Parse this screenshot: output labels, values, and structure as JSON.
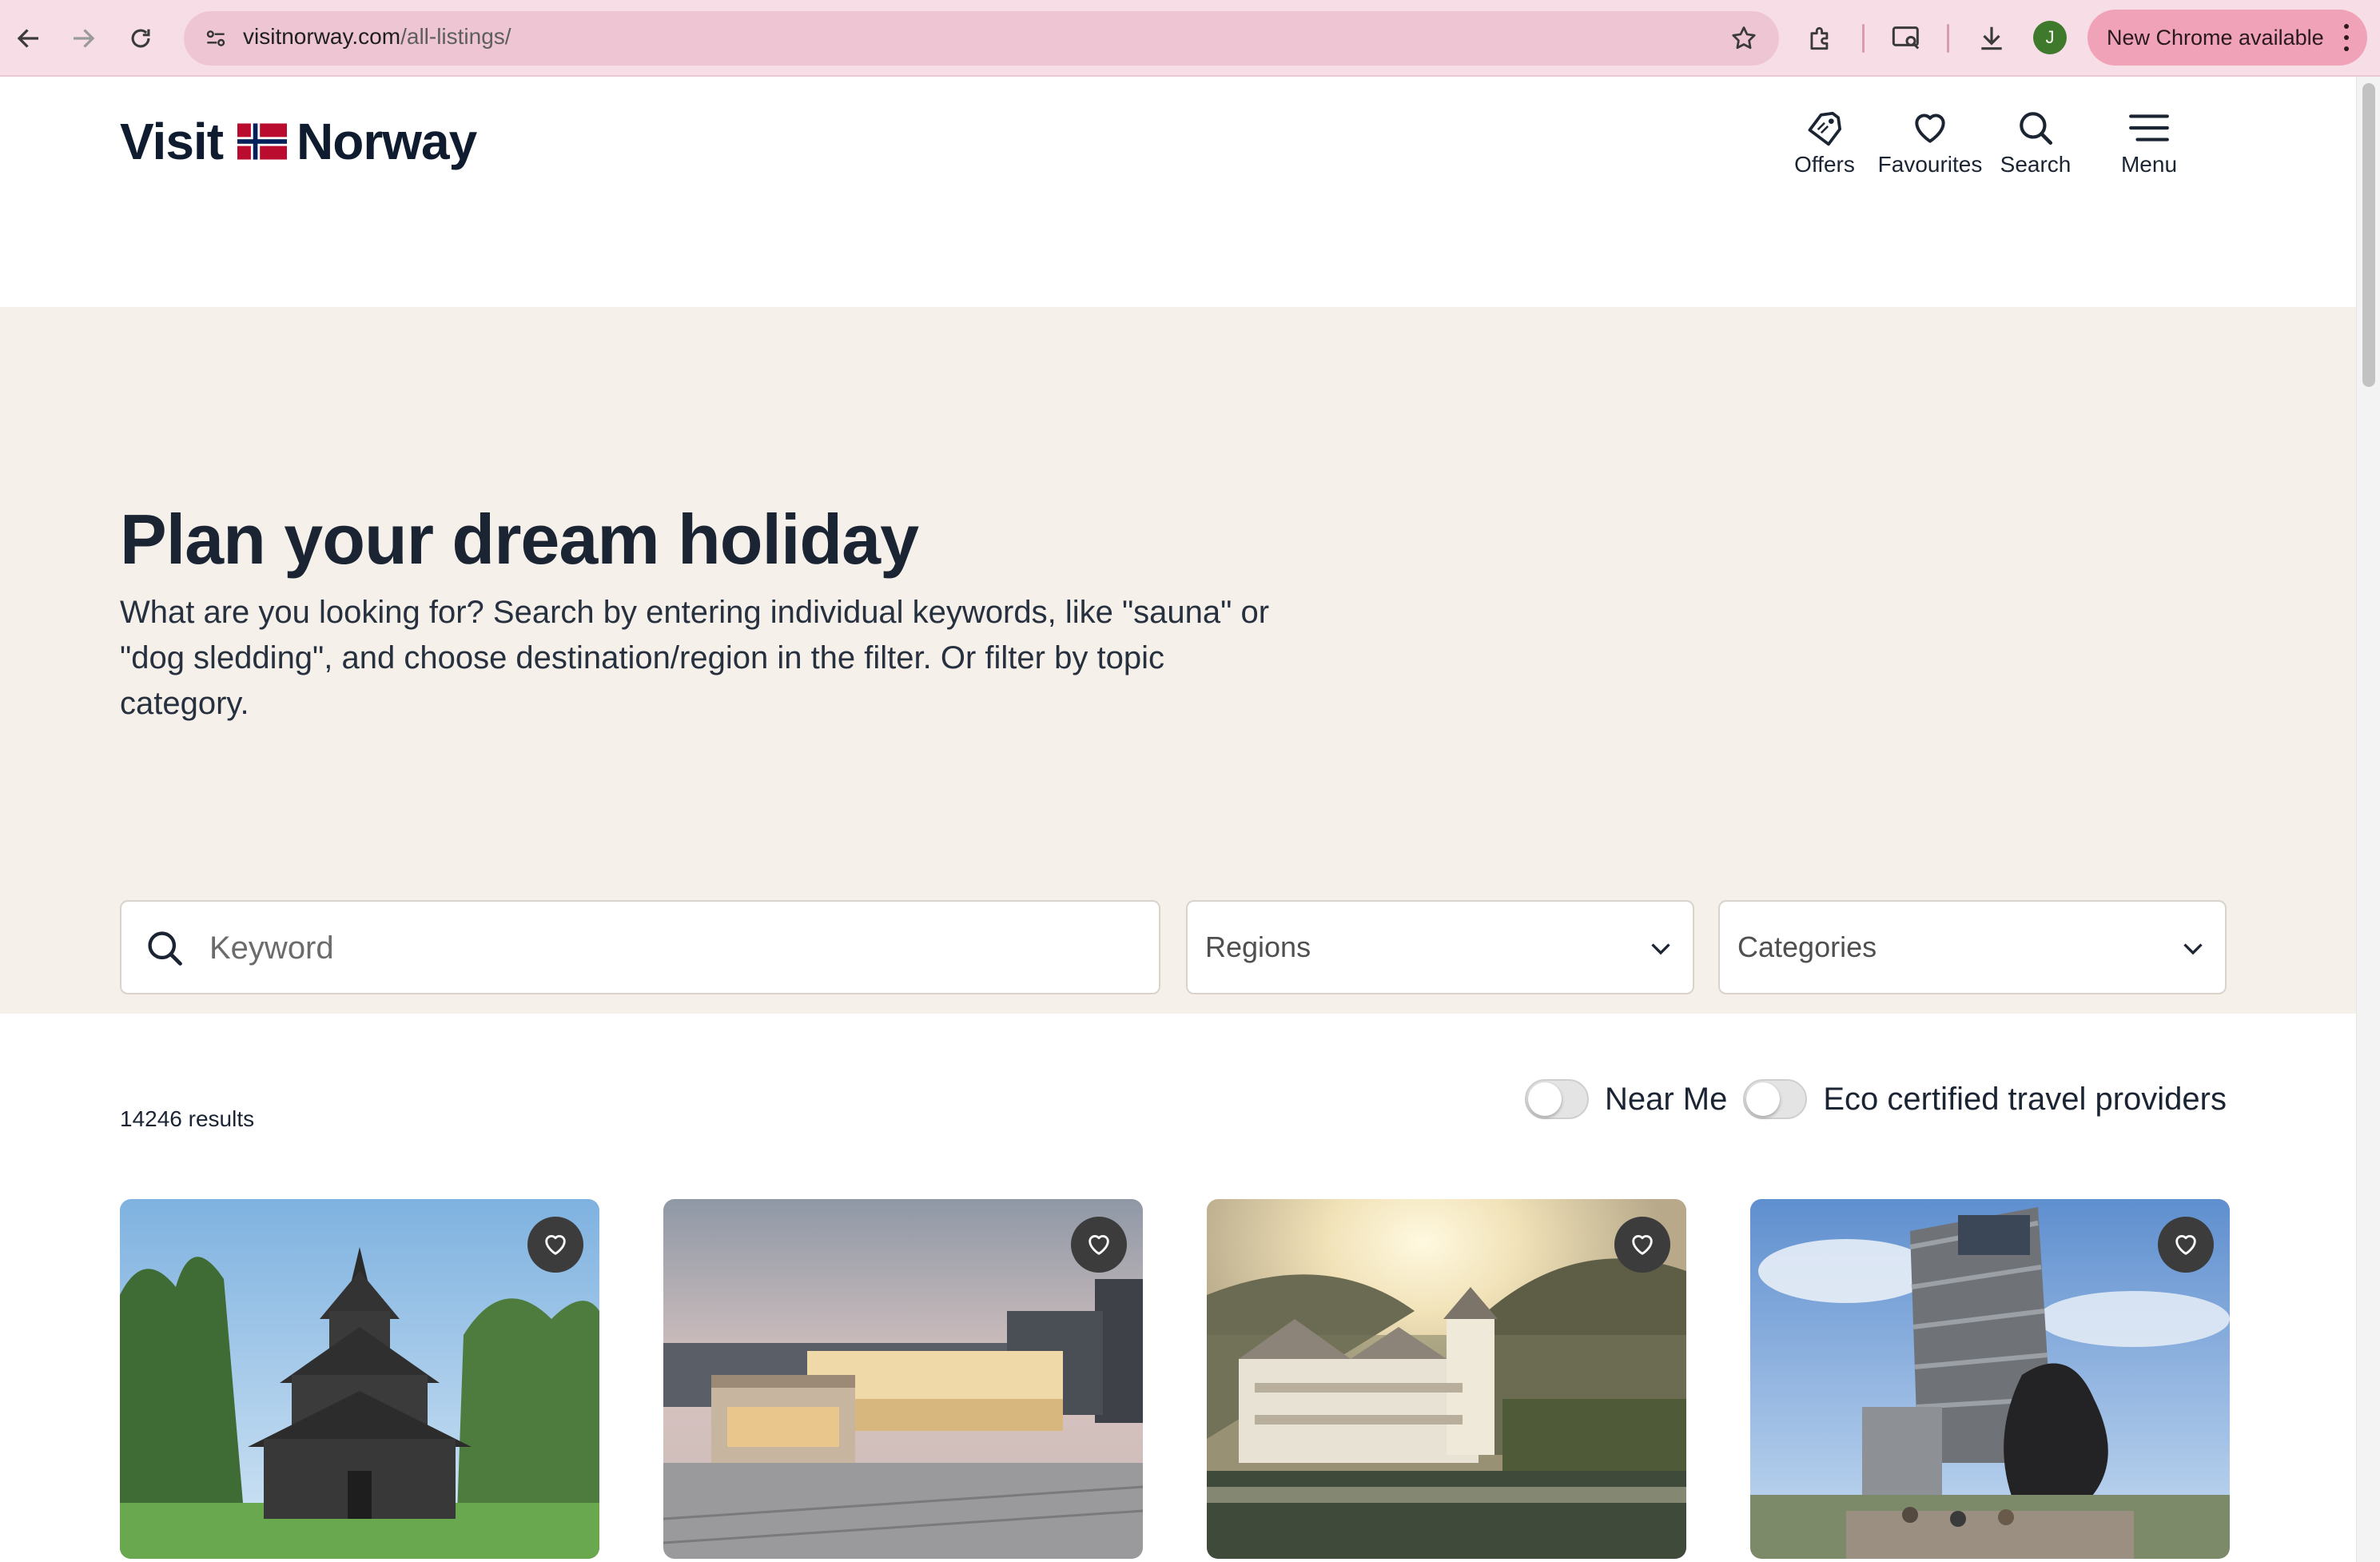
{
  "browser": {
    "url_host": "visitnorway.com",
    "url_path": "/all-listings/",
    "profile_initial": "J",
    "update_label": "New Chrome available"
  },
  "header": {
    "logo_left": "Visit",
    "logo_right": "Norway",
    "nav": [
      {
        "label": "Offers",
        "icon": "tag-icon"
      },
      {
        "label": "Favourites",
        "icon": "heart-icon"
      },
      {
        "label": "Search",
        "icon": "search-icon"
      },
      {
        "label": "Menu",
        "icon": "hamburger-icon"
      }
    ]
  },
  "hero": {
    "title": "Plan your dream holiday",
    "intro": "What are you looking for? Search by entering individual keywords, like \"sauna\" or \"dog sledding\", and choose destination/region in the filter. Or filter by topic category.",
    "keyword_placeholder": "Keyword",
    "regions_label": "Regions",
    "categories_label": "Categories"
  },
  "results": {
    "count_text": "14246 results",
    "toggles": [
      {
        "label": "Near Me",
        "on": false
      },
      {
        "label": "Eco certified travel providers",
        "on": false
      }
    ]
  },
  "cards": [
    {
      "subject": "stave church among trees"
    },
    {
      "subject": "national museum plaza at dusk"
    },
    {
      "subject": "waterfront hotel in fjord valley"
    },
    {
      "subject": "modern museum tower with sculpture"
    }
  ],
  "colors": {
    "chrome_bg": "#f7dde6",
    "hero_bg": "#f5f0ea",
    "text_dark": "#1b2433",
    "fav_button": "#3c3c3c",
    "flag_red": "#ba0c2f",
    "flag_blue": "#00205b"
  }
}
